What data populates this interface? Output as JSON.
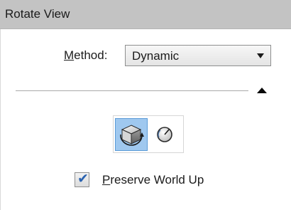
{
  "panel": {
    "title": "Rotate View"
  },
  "method": {
    "label_prefix": "",
    "label_underlined": "M",
    "label_rest": "ethod:",
    "selected": "Dynamic"
  },
  "modes": [
    {
      "name": "dynamic-rotation",
      "selected": true,
      "icon": "rotating-cube-icon"
    },
    {
      "name": "angle-rotation",
      "selected": false,
      "icon": "angle-dial-icon"
    }
  ],
  "options": {
    "preserve_world_up": {
      "checked": true,
      "label_underlined": "P",
      "label_rest": "reserve World Up"
    }
  },
  "colors": {
    "titlebar_bg": "#c3c3c3",
    "selected_button_bg": "#9fc8ef",
    "selected_button_border": "#5b9bd8",
    "check_mark": "#2b63b0"
  }
}
